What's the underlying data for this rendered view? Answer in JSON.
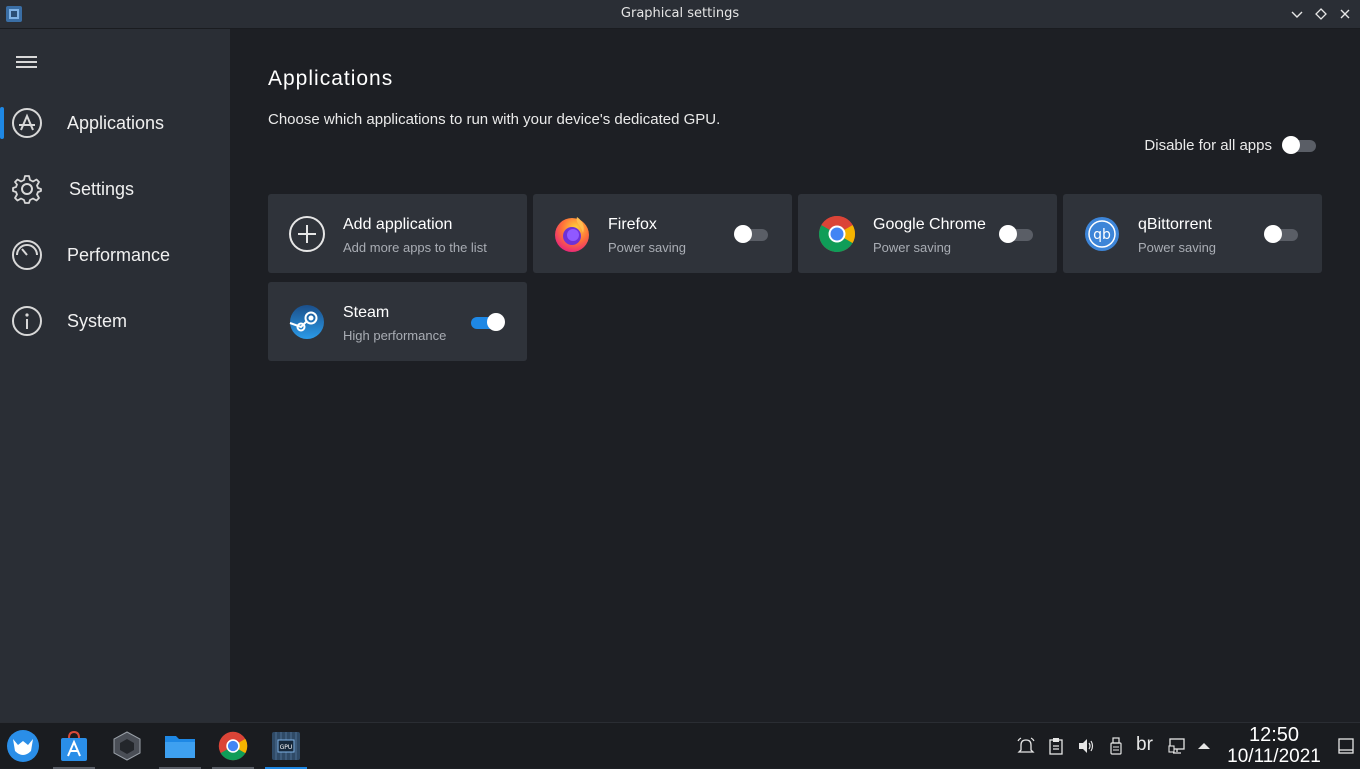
{
  "window": {
    "title": "Graphical settings",
    "buttons": [
      "chevron-down-icon",
      "diamond-icon",
      "close-icon"
    ]
  },
  "sidebar": {
    "menu_icon": "hamburger-icon",
    "items": [
      {
        "label": "Applications",
        "icon": "app-store-icon",
        "active": true
      },
      {
        "label": "Settings",
        "icon": "gear-icon",
        "active": false
      },
      {
        "label": "Performance",
        "icon": "gauge-icon",
        "active": false
      },
      {
        "label": "System",
        "icon": "info-icon",
        "active": false
      }
    ]
  },
  "main": {
    "title": "Applications",
    "description": "Choose which applications to run with your device's dedicated GPU.",
    "disable_all": {
      "label": "Disable for all apps",
      "enabled": false
    },
    "cards": [
      {
        "title": "Add application",
        "subtitle": "Add more apps to the list",
        "icon": "plus-circle-icon",
        "has_toggle": false
      },
      {
        "title": "Firefox",
        "subtitle": "Power saving",
        "icon": "firefox-icon",
        "has_toggle": true,
        "enabled": false
      },
      {
        "title": "Google Chrome",
        "subtitle": "Power saving",
        "icon": "chrome-icon",
        "has_toggle": true,
        "enabled": false
      },
      {
        "title": "qBittorrent",
        "subtitle": "Power saving",
        "icon": "qbittorrent-icon",
        "has_toggle": true,
        "enabled": false
      },
      {
        "title": "Steam",
        "subtitle": "High performance",
        "icon": "steam-icon",
        "has_toggle": true,
        "enabled": true
      }
    ]
  },
  "taskbar": {
    "apps": [
      "launcher-icon",
      "app-store-icon",
      "gamecube-icon",
      "files-icon",
      "chrome-icon",
      "gpu-settings-icon"
    ],
    "tray": [
      "notification-bell-icon",
      "clipboard-icon",
      "volume-icon",
      "usb-icon",
      "keyboard-layout",
      "network-icon",
      "arrow-up-icon"
    ],
    "keyboard_layout": "br",
    "clock": {
      "time": "12:50",
      "date": "10/11/2021"
    }
  },
  "colors": {
    "accent": "#1e88e5",
    "sidebar_bg": "#2a2e35",
    "main_bg": "#1d1f24",
    "card_bg": "#2f333a"
  }
}
